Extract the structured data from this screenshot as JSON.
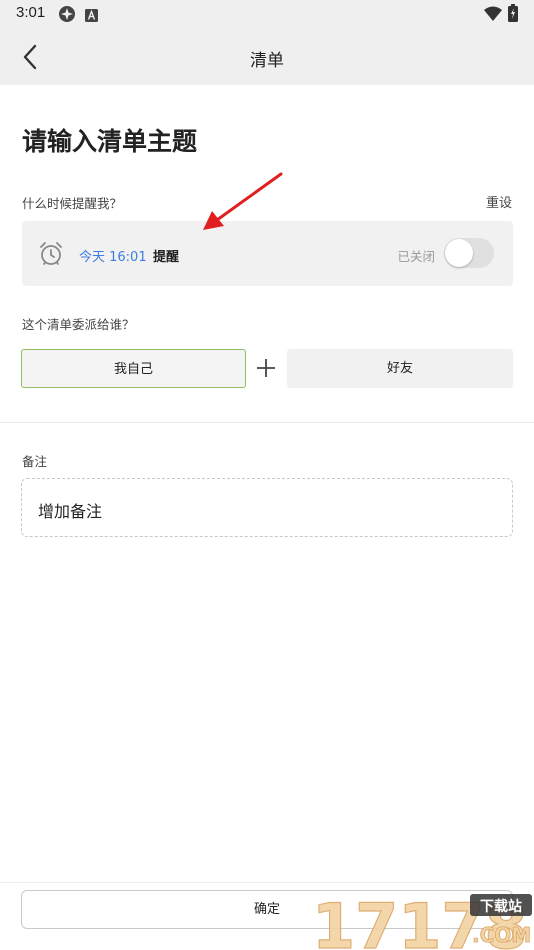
{
  "status_bar": {
    "time": "3:01",
    "icons": [
      "app-notification-icon",
      "a-letter-icon",
      "wifi-icon",
      "battery-icon"
    ]
  },
  "header": {
    "title": "清单",
    "back_icon": "chevron-left-icon"
  },
  "page": {
    "title_placeholder": "请输入清单主题"
  },
  "reminder": {
    "question": "什么时候提醒我？",
    "reset_label": "重设",
    "time_text": "今天 16:01",
    "label": "提醒",
    "toggle_state_text": "已关闭",
    "toggle_on": false,
    "icon": "alarm-clock-icon",
    "time_color": "#3b7de0"
  },
  "assign": {
    "question": "这个清单委派给谁？",
    "self_label": "我自己",
    "friend_label": "好友",
    "selected": "self",
    "selected_border_color": "#8fbd62"
  },
  "note": {
    "label": "备注",
    "placeholder": "增加备注"
  },
  "footer": {
    "confirm_label": "确定"
  },
  "watermark": {
    "brand": "17178",
    "tag": "下载站",
    "domain": ".COM"
  },
  "annotation": {
    "arrow_color": "#e02020"
  }
}
